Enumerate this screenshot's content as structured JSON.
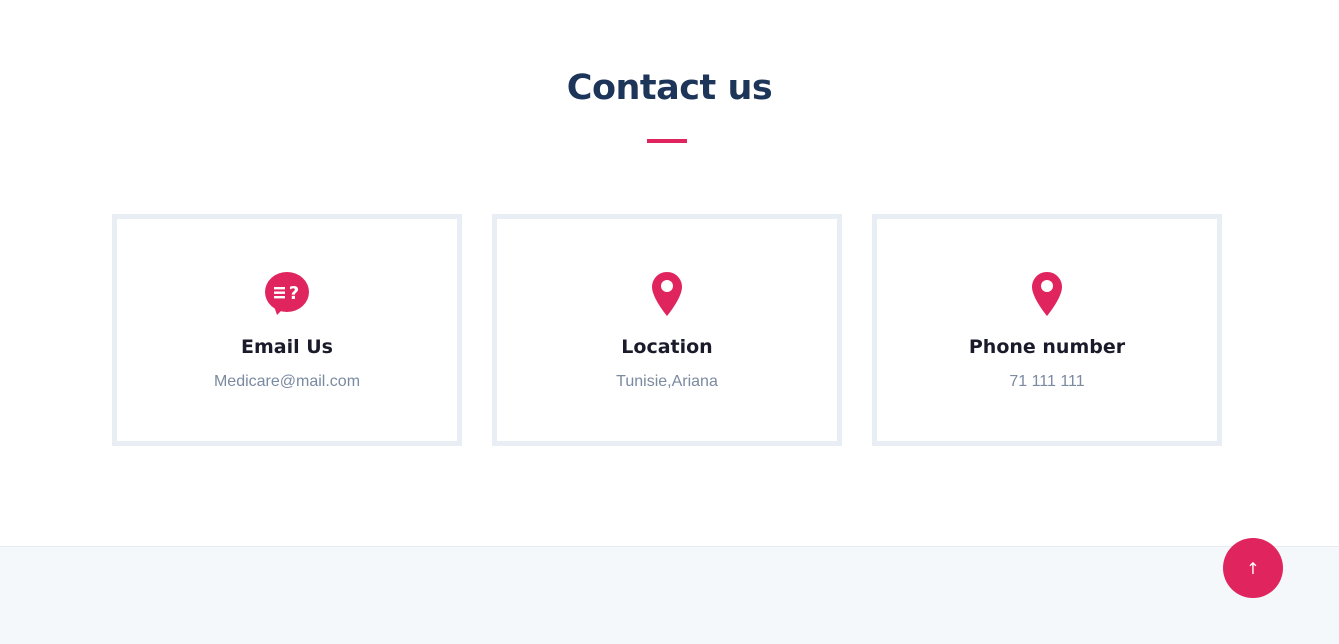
{
  "contact": {
    "title": "Contact us",
    "accent_color": "#e0245e",
    "title_color": "#1c3559",
    "cards": [
      {
        "icon": "question-chat-icon",
        "title": "Email Us",
        "text": "Medicare@mail.com"
      },
      {
        "icon": "map-pin-icon",
        "title": "Location",
        "text": "Tunisie,Ariana"
      },
      {
        "icon": "map-pin-icon",
        "title": "Phone number",
        "text": "71 111 111"
      }
    ]
  },
  "back_to_top": {
    "icon": "arrow-up-icon",
    "label": "↑"
  }
}
